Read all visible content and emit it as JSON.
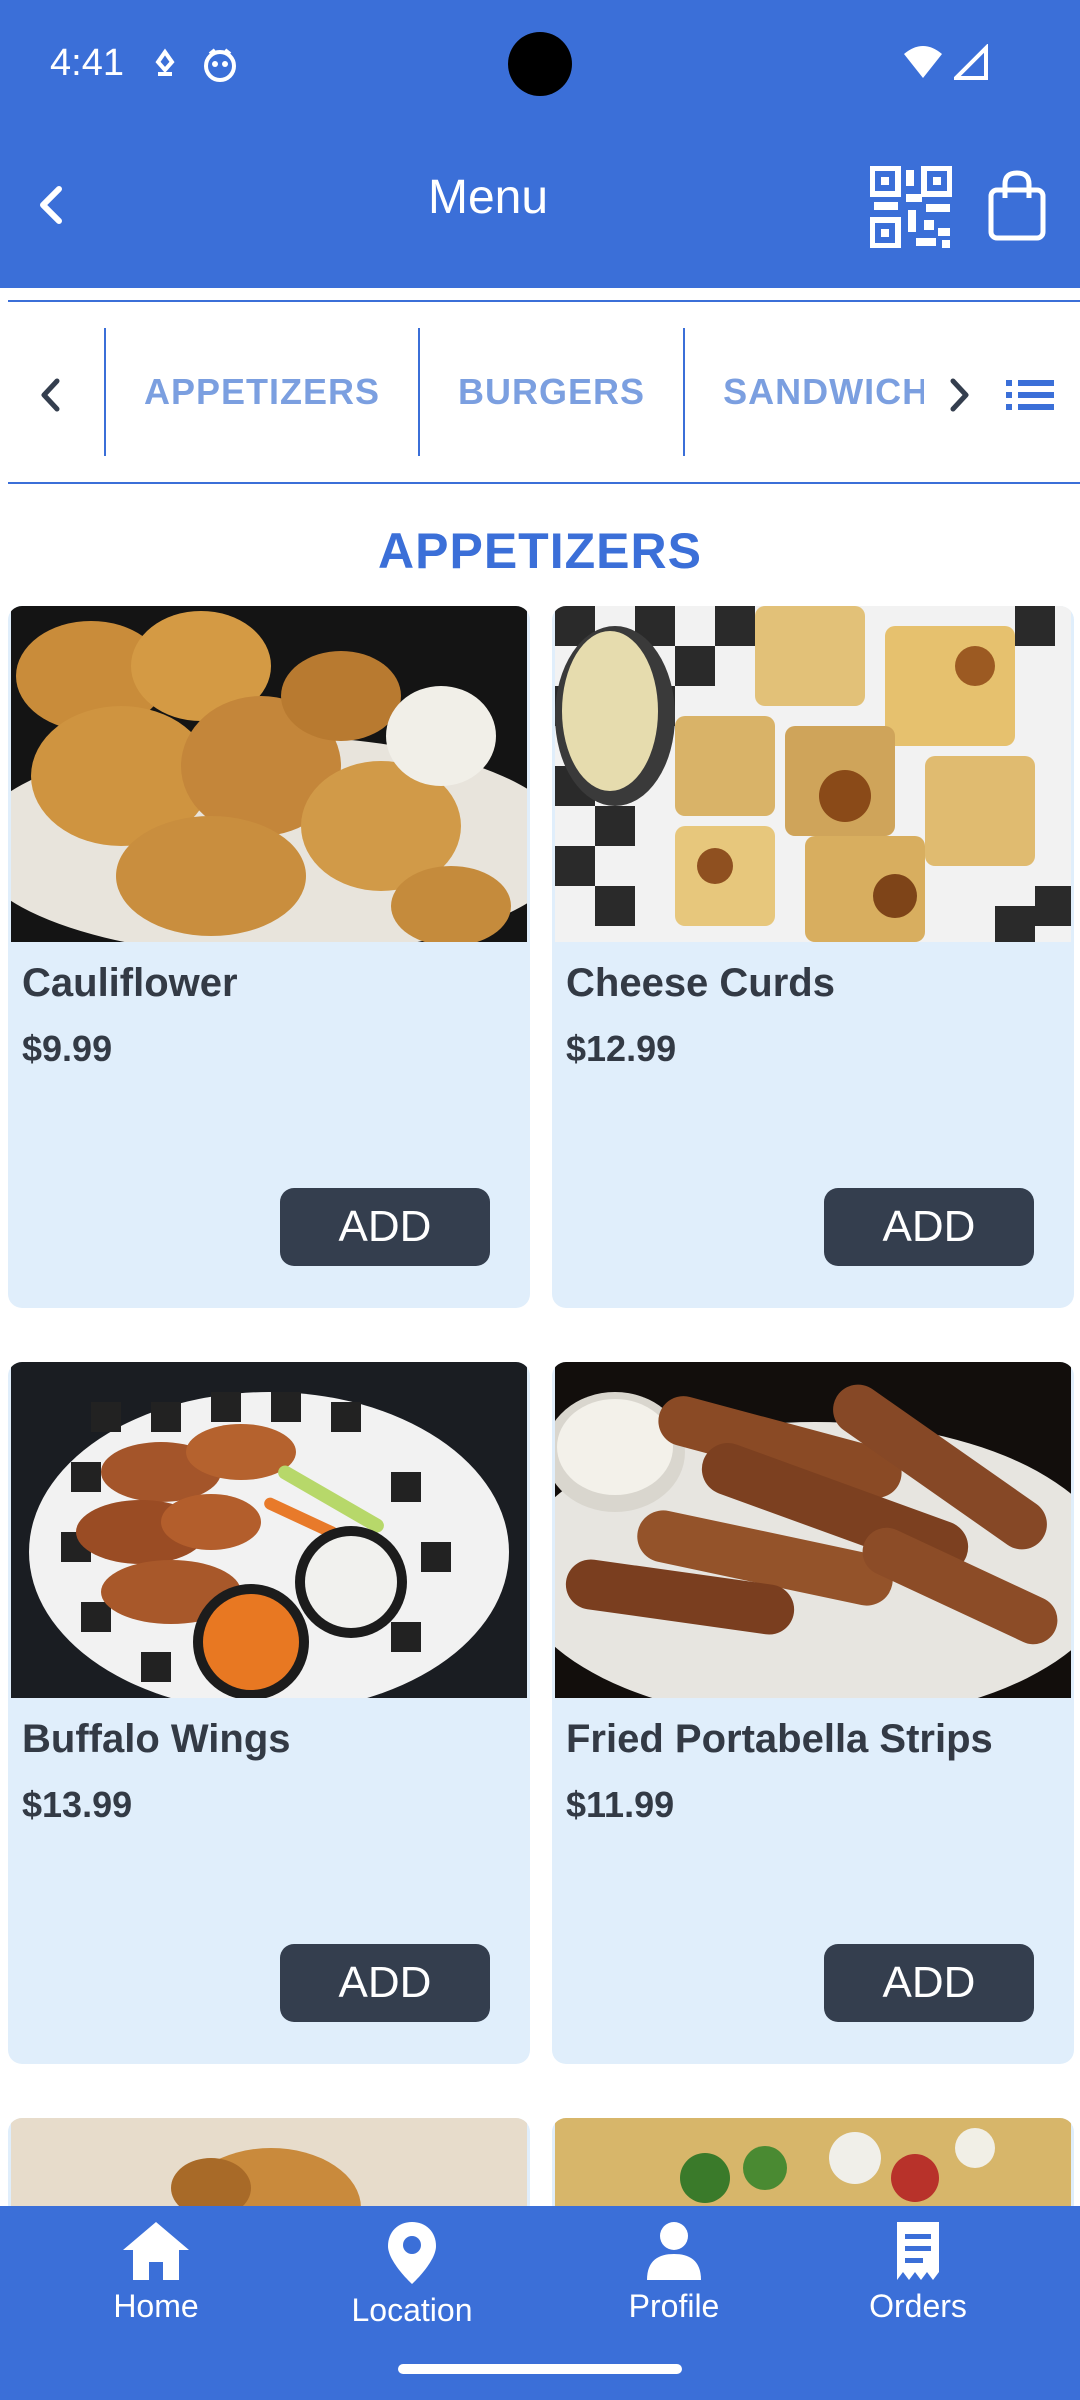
{
  "status_bar": {
    "time": "4:41"
  },
  "header": {
    "title": "Menu"
  },
  "categories": {
    "tabs": [
      {
        "label": "APPETIZERS"
      },
      {
        "label": "BURGERS"
      },
      {
        "label": "SANDWICHES"
      }
    ]
  },
  "section": {
    "title": "APPETIZERS"
  },
  "items": [
    {
      "name": "Cauliflower",
      "price": "$9.99",
      "add_label": "ADD"
    },
    {
      "name": "Cheese Curds",
      "price": "$12.99",
      "add_label": "ADD"
    },
    {
      "name": "Buffalo Wings",
      "price": "$13.99",
      "add_label": "ADD"
    },
    {
      "name": "Fried Portabella Strips",
      "price": "$11.99",
      "add_label": "ADD"
    }
  ],
  "bottom_nav": {
    "items": [
      {
        "label": "Home",
        "icon": "home-icon"
      },
      {
        "label": "Location",
        "icon": "location-pin-icon"
      },
      {
        "label": "Profile",
        "icon": "person-icon"
      },
      {
        "label": "Orders",
        "icon": "receipt-icon"
      }
    ]
  },
  "colors": {
    "primary": "#3b6fd8",
    "card_bg": "#e0eefb",
    "button": "#343e4e",
    "text_dark": "#333a45",
    "tab_text": "#7b9fe0"
  }
}
